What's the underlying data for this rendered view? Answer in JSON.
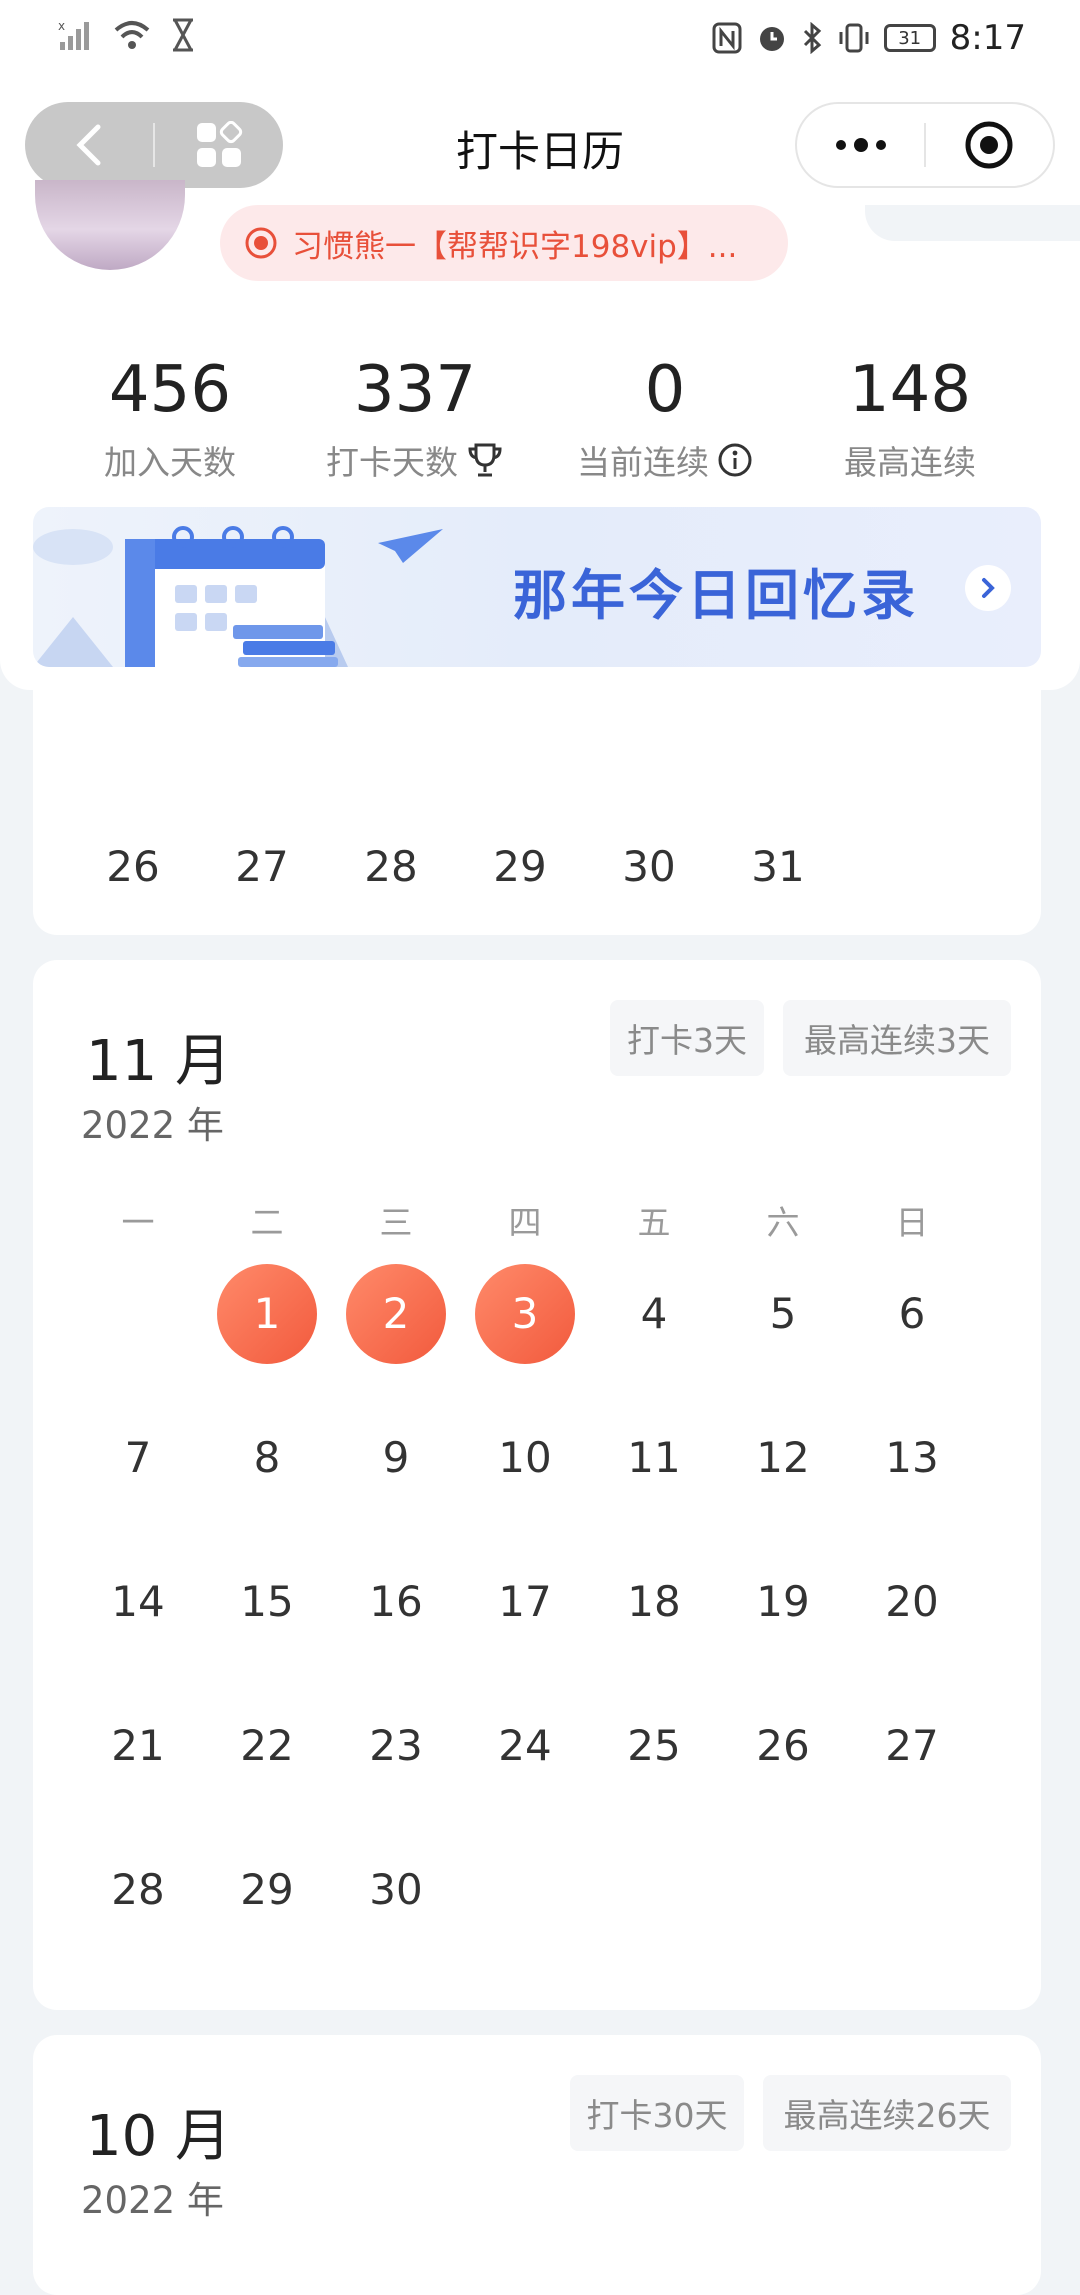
{
  "status_bar": {
    "time": "8:17",
    "battery": "31"
  },
  "nav": {
    "title": "打卡日历"
  },
  "profile": {
    "habit_name": "习惯熊一【帮帮识字198vip】..."
  },
  "stats": [
    {
      "value": "456",
      "label": "加入天数"
    },
    {
      "value": "337",
      "label": "打卡天数"
    },
    {
      "value": "0",
      "label": "当前连续"
    },
    {
      "value": "148",
      "label": "最高连续"
    }
  ],
  "banner": {
    "title": "那年今日回忆录"
  },
  "prev_month_tail": {
    "days": [
      "26",
      "27",
      "28",
      "29",
      "30",
      "31"
    ]
  },
  "weekdays": [
    "一",
    "二",
    "三",
    "四",
    "五",
    "六",
    "日"
  ],
  "november": {
    "month": "11 月",
    "year": "2022 年",
    "chip_checkin": "打卡3天",
    "chip_streak": "最高连续3天",
    "checked_days": [
      1,
      2,
      3
    ],
    "first_weekday_index": 1,
    "days_in_month": 30
  },
  "october": {
    "month": "10 月",
    "year": "2022 年",
    "chip_checkin": "打卡30天",
    "chip_streak": "最高连续26天"
  },
  "colors": {
    "accent": "#f25a3d",
    "banner_text": "#3a64d8"
  }
}
